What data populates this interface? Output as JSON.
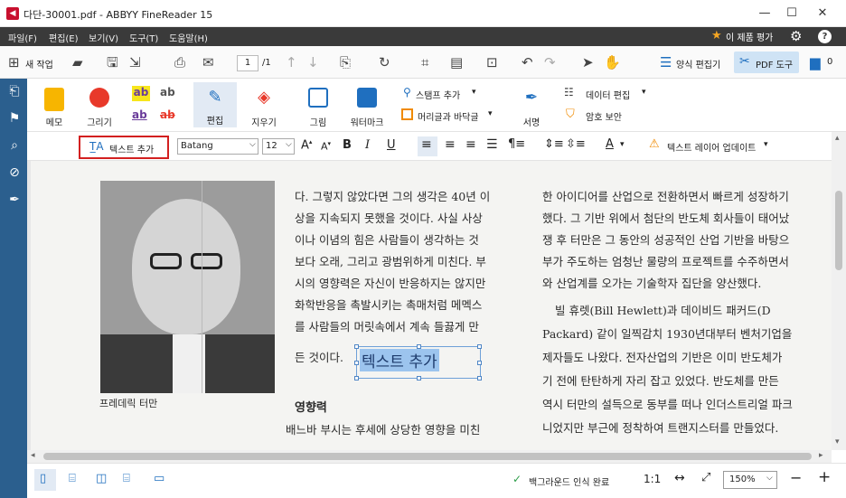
{
  "window": {
    "title": "다단-30001.pdf - ABBYY FineReader 15",
    "logo_icon": "abbyy-logo-icon",
    "controls": [
      "—",
      "☐",
      "✕"
    ]
  },
  "menu": {
    "items": [
      "파일(F)",
      "편집(E)",
      "보기(V)",
      "도구(T)",
      "도움말(H)"
    ],
    "rate_label": "이 제품 평가"
  },
  "toolbar": {
    "new_task": "새 작업",
    "page_current": "1",
    "page_total": "/1",
    "form_editor": "양식 편집기",
    "pdf_tools": "PDF 도구",
    "comments_count": "0"
  },
  "ribbon": {
    "memo": "메모",
    "draw": "그리기",
    "edit": "편집",
    "erase": "지우기",
    "picture": "그림",
    "watermark": "워터마크",
    "stamp_add": "스탬프 추가",
    "header_footer": "머리글과 바닥글",
    "signature": "서명",
    "data_edit": "데이터 편집",
    "password_security": "암호 보안"
  },
  "format_bar": {
    "add_text": "텍스트 추가",
    "font": "Batang",
    "size": "12",
    "update_text_layer": "텍스트 레이어 업데이트"
  },
  "document": {
    "col2_lines": [
      "다. 그렇지 않았다면 그의 생각은 40년 이",
      "상을 지속되지 못했을 것이다. 사실 사상",
      "이나 이념의 힘은 사람들이 생각하는 것",
      "보다 오래, 그리고 광범위하게 미친다. 부",
      "시의 영향력은 자신이 반응하지는 않지만",
      "화학반응을 촉발시키는 촉매처럼 메멕스",
      "를 사람들의 머릿속에서 계속 들끓게 만",
      "든 것이다."
    ],
    "col3_lines": [
      "한 아이디어를 산업으로 전환하면서 빠르게 성장하기",
      "했다. 그 기반 위에서 첨단의 반도체 회사들이 태어났",
      "쟁 후 터만은 그 동안의 성공적인 산업 기반을 바탕으",
      "부가 주도하는 엄청난 물량의 프로젝트를 수주하면서",
      "와 산업계를 오가는 기술학자 집단을 양산했다.",
      "빌 휴렛(Bill Hewlett)과 데이비드 패커드(D",
      "Packard) 같이 일찍감치 1930년대부터 벤처기업을",
      "제자들도 나왔다. 전자산업의 기반은 이미 반도체가",
      "기 전에 탄탄하게 자리 잡고 있었다. 반도체를 만든",
      "역시 터만의 설득으로 동부를 떠나 인더스트리얼 파크",
      "니었지만 부근에 정착하여 트랜지스터를 만들었다."
    ],
    "added_text": "텍스트 추가",
    "photo_caption": "프레데릭 터만",
    "section_heading": "영향력",
    "section_first_line": "배느바 부시는 후세에 상당한 영향을 미친"
  },
  "status": {
    "background_ocr": "백그라운드 인식 완료",
    "zoom": "150%",
    "ratio": "1:1"
  },
  "colors": {
    "menubar": "#3a3a3a",
    "sidebar": "#2b5f8e",
    "accent_red": "#d32020",
    "selection_blue": "#6ea0d8"
  }
}
